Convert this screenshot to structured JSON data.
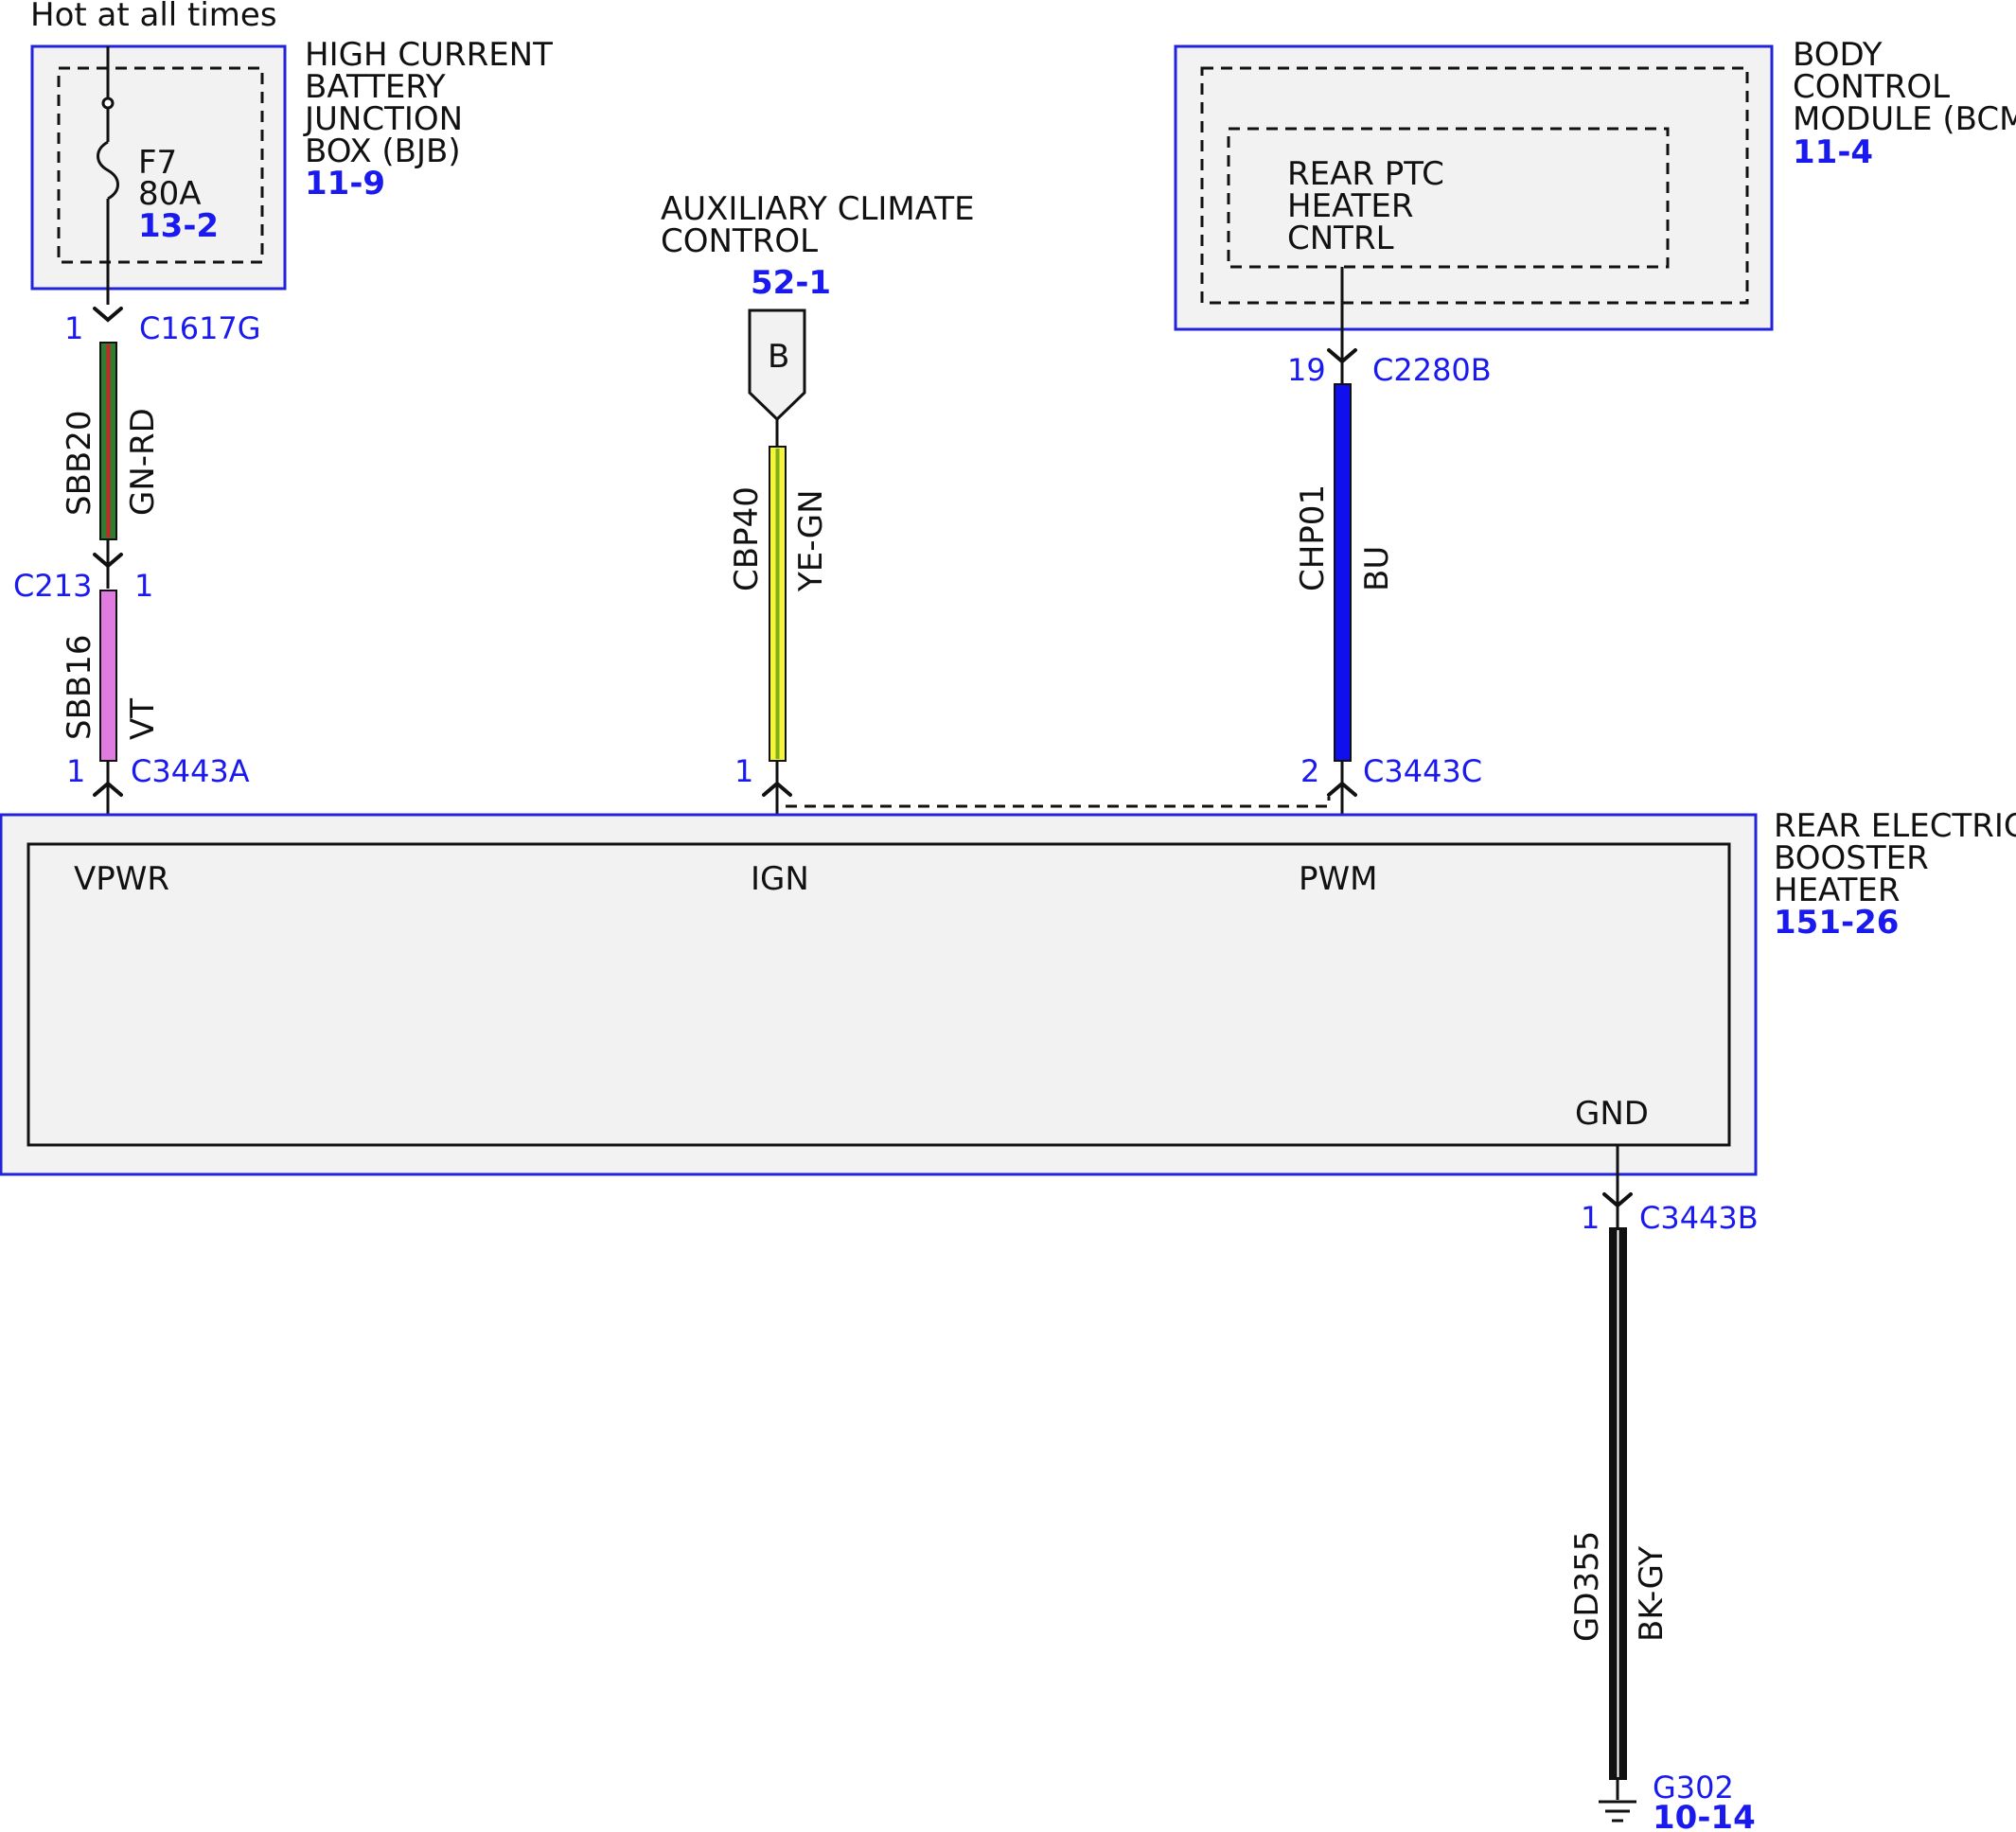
{
  "supply_label": "Hot at all times",
  "bjb": {
    "name": [
      "HIGH CURRENT",
      "BATTERY",
      "JUNCTION",
      "BOX (BJB)"
    ],
    "ref": "11-9",
    "fuse_name": "F7",
    "fuse_rating": "80A",
    "fuse_ref": "13-2"
  },
  "bcm": {
    "name": [
      "BODY",
      "CONTROL",
      "MODULE (BCM)"
    ],
    "ref": "11-4",
    "sub_name": [
      "REAR PTC",
      "HEATER",
      "CNTRL"
    ]
  },
  "acc": {
    "name": [
      "AUXILIARY CLIMATE",
      "CONTROL"
    ],
    "ref": "52-1",
    "tag": "B"
  },
  "heater": {
    "name": [
      "REAR ELECTRIC",
      "BOOSTER",
      "HEATER"
    ],
    "ref": "151-26",
    "pins": {
      "vpwr": "VPWR",
      "ign": "IGN",
      "pwm": "PWM",
      "gnd": "GND"
    }
  },
  "connectors": {
    "c1617g": {
      "pin": "1",
      "name": "C1617G"
    },
    "c213": {
      "pin": "1",
      "name": "C213"
    },
    "c3443a": {
      "pin": "1",
      "name": "C3443A"
    },
    "acc_pin": {
      "pin": "1"
    },
    "c2280b": {
      "pin": "19",
      "name": "C2280B"
    },
    "c3443c": {
      "pin": "2",
      "name": "C3443C"
    },
    "c3443b": {
      "pin": "1",
      "name": "C3443B"
    }
  },
  "wires": {
    "sbb20": {
      "circuit": "SBB20",
      "color": "GN-RD"
    },
    "sbb16": {
      "circuit": "SBB16",
      "color": "VT"
    },
    "cbp40": {
      "circuit": "CBP40",
      "color": "YE-GN"
    },
    "chp01": {
      "circuit": "CHP01",
      "color": "BU"
    },
    "gd355": {
      "circuit": "GD355",
      "color": "BK-GY"
    }
  },
  "ground": {
    "name": "G302",
    "ref": "10-14"
  },
  "colors": {
    "gn_rd_main": "#2e7d32",
    "gn_rd_stripe": "#c62828",
    "vt": "#e07be0",
    "ye_gn_main": "#f5f53a",
    "ye_gn_stripe": "#7fae1a",
    "bu": "#1010ee",
    "bk_gy": "#111111",
    "link_blue": "#1a1aee"
  }
}
